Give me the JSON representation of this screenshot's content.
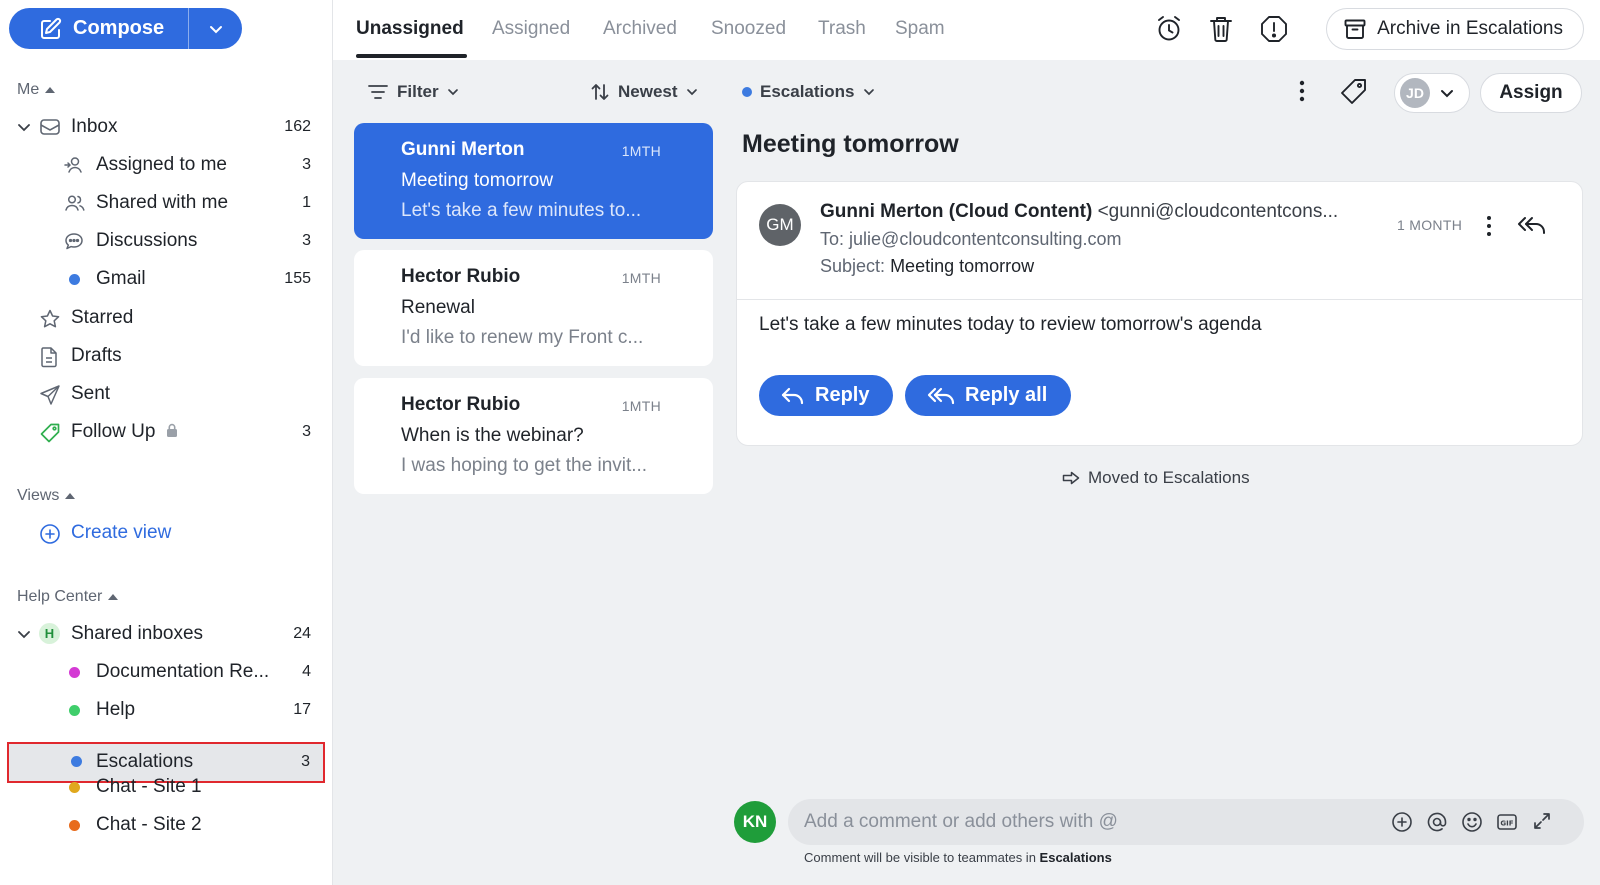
{
  "sidebar": {
    "compose_label": "Compose",
    "me_section": "Me",
    "inbox": {
      "label": "Inbox",
      "count": "162"
    },
    "me_items": [
      {
        "label": "Assigned to me",
        "count": "3"
      },
      {
        "label": "Shared with me",
        "count": "1"
      },
      {
        "label": "Discussions",
        "count": "3"
      },
      {
        "label": "Gmail",
        "count": "155",
        "color": "#3d7be0"
      }
    ],
    "starred": "Starred",
    "drafts": "Drafts",
    "sent": "Sent",
    "follow_up": {
      "label": "Follow Up",
      "count": "3"
    },
    "views_section": "Views",
    "create_view": "Create view",
    "help_section": "Help Center",
    "shared_inboxes": {
      "badge": "H",
      "label": "Shared inboxes",
      "count": "24"
    },
    "shared_items": [
      {
        "label": "Documentation Re...",
        "count": "4",
        "color": "#d43ad4"
      },
      {
        "label": "Help",
        "count": "17",
        "color": "#3fce6b"
      },
      {
        "label": "Escalations",
        "count": "3",
        "color": "#3d7be0"
      },
      {
        "label": "Chat - Site 1",
        "count": "",
        "color": "#e0a81d"
      },
      {
        "label": "Chat - Site 2",
        "count": "",
        "color": "#e86b1c"
      }
    ]
  },
  "tabs": [
    "Unassigned",
    "Assigned",
    "Archived",
    "Snoozed",
    "Trash",
    "Spam"
  ],
  "topbar": {
    "archive_label": "Archive in Escalations"
  },
  "list": {
    "filter_label": "Filter",
    "sort_label": "Newest",
    "cards": [
      {
        "from": "Gunni Merton",
        "time": "1MTH",
        "subject": "Meeting tomorrow",
        "preview": "Let's take a few minutes to..."
      },
      {
        "from": "Hector Rubio",
        "time": "1MTH",
        "subject": "Renewal",
        "preview": "I'd like to renew my Front c..."
      },
      {
        "from": "Hector Rubio",
        "time": "1MTH",
        "subject": "When is the webinar?",
        "preview": "I was hoping to get the invit..."
      }
    ]
  },
  "conversation": {
    "inbox_label": "Escalations",
    "assignee_initials": "JD",
    "assign_label": "Assign",
    "title": "Meeting tomorrow",
    "message": {
      "avatar": "GM",
      "from_name": "Gunni Merton (Cloud Content)",
      "from_email": "<gunni@cloudcontentcons...",
      "to_label": "To:",
      "to": "julie@cloudcontentconsulting.com",
      "subject_label": "Subject:",
      "subject": "Meeting tomorrow",
      "time": "1 MONTH",
      "body": "Let's take a few minutes today to review tomorrow's agenda",
      "reply_label": "Reply",
      "reply_all_label": "Reply all"
    },
    "event": "Moved to Escalations",
    "comment": {
      "avatar": "KN",
      "placeholder": "Add a comment or add others with @",
      "note_prefix": "Comment will be visible to teammates in",
      "note_inbox": "Escalations"
    }
  }
}
